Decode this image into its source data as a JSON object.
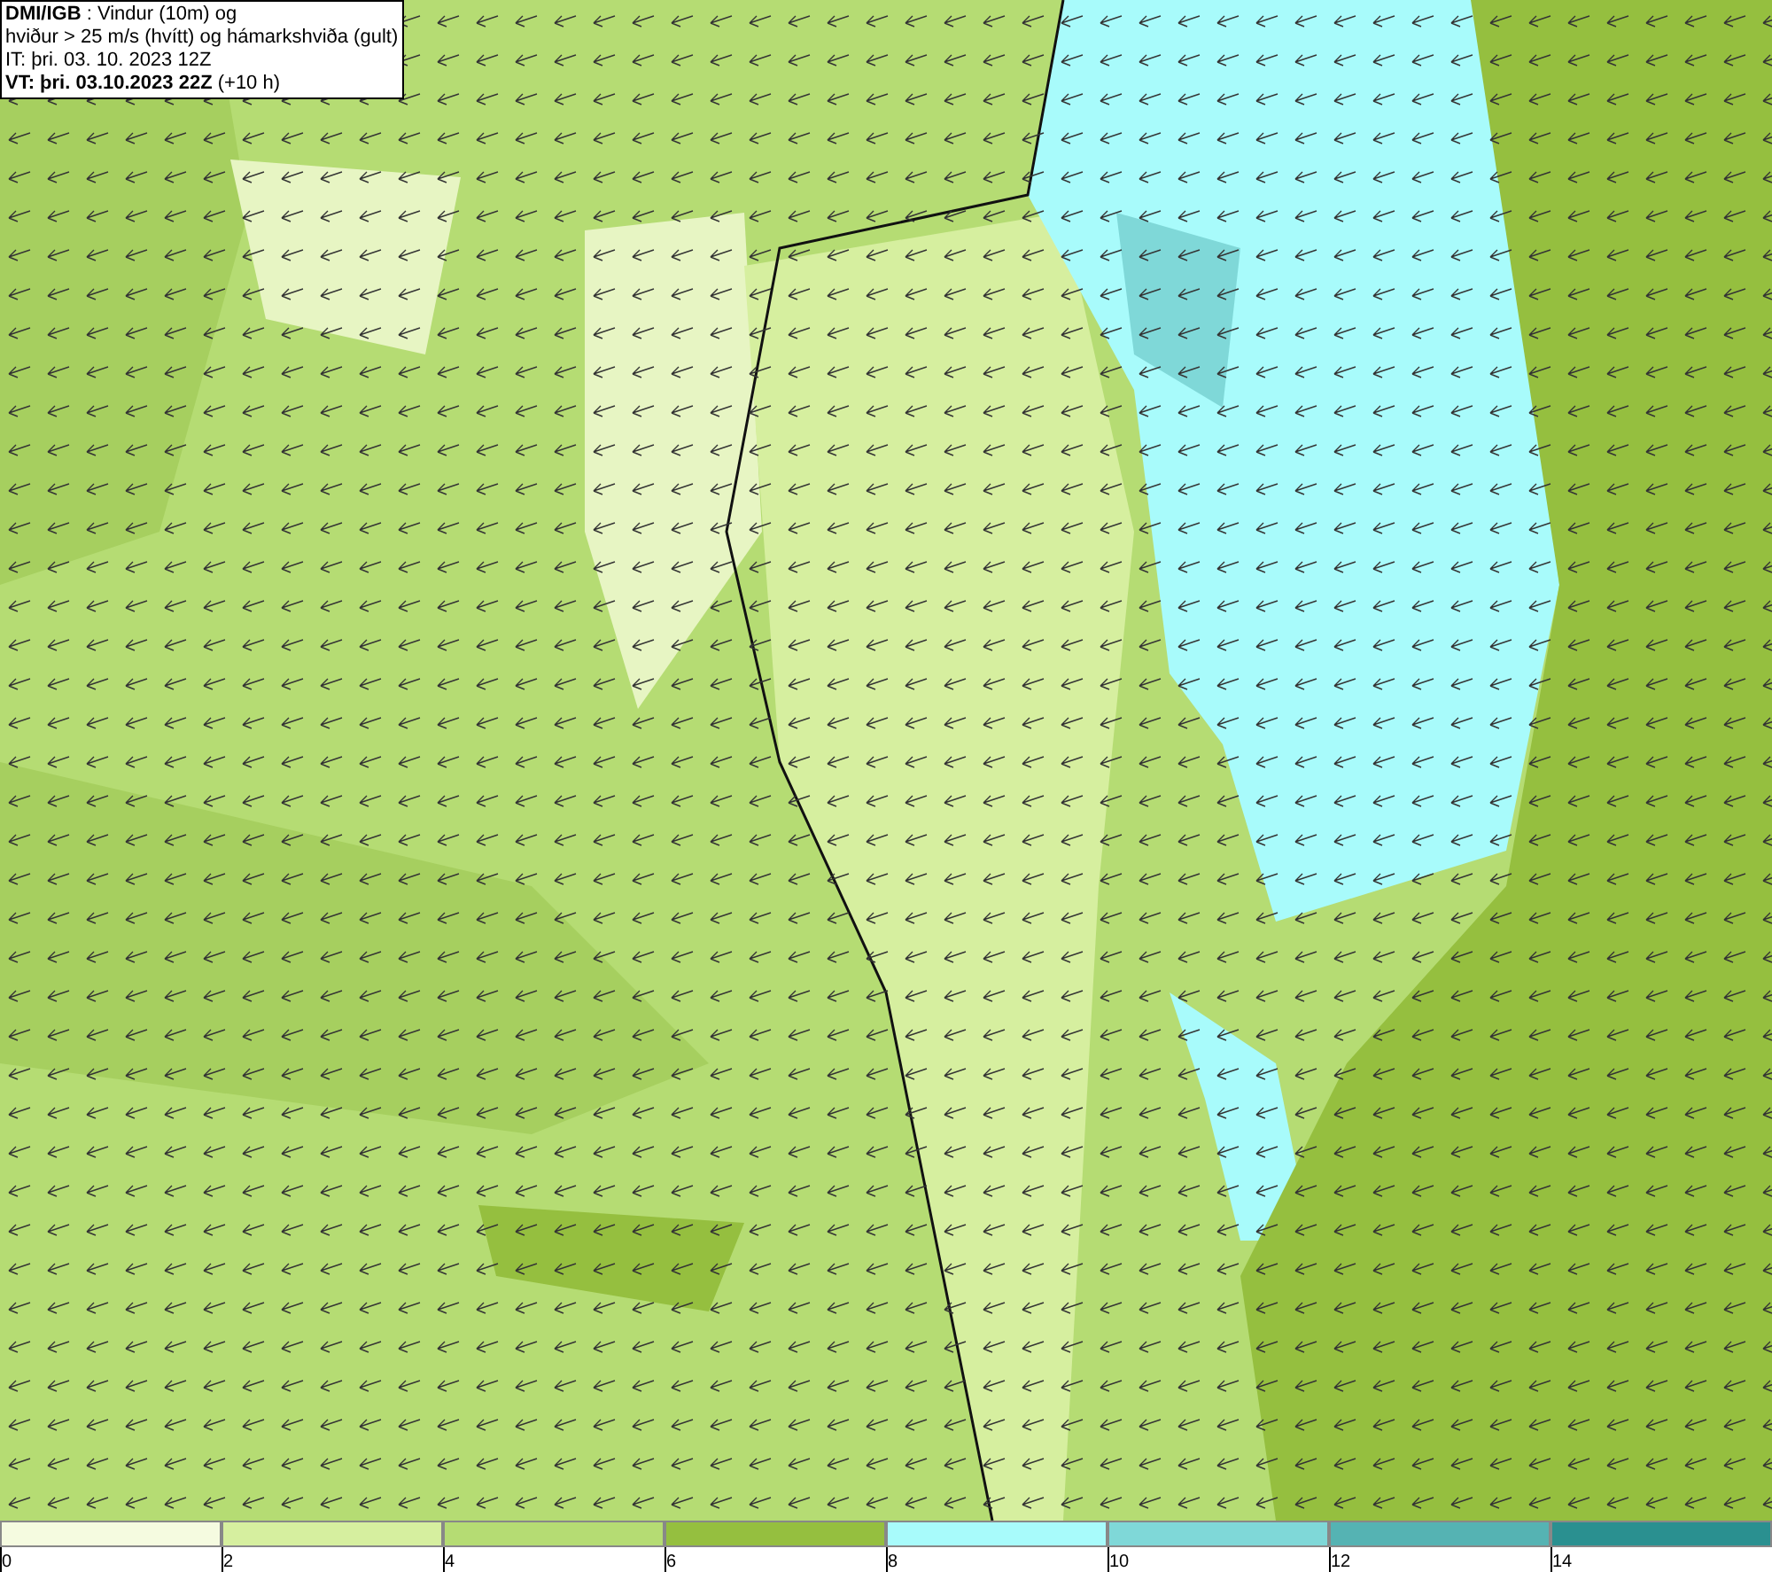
{
  "info_box": {
    "lines": [
      "**DMI/IGB** : Vindur (10m) og",
      "hviður > 25 m/s (hvítt) og hámarkshviða (gult)",
      "IT: þri. 03. 10. 2023 12Z",
      "**VT: þri. 03.10.2023 22Z** (+10 h)"
    ]
  },
  "legend": {
    "bins": [
      {
        "color": "#f5fbe0",
        "label": "0"
      },
      {
        "color": "#d6ef9f",
        "label": "2"
      },
      {
        "color": "#b5dc73",
        "label": "4"
      },
      {
        "color": "#95bf3f",
        "label": "6"
      },
      {
        "color": "#a8fbfb",
        "label": "8"
      },
      {
        "color": "#7fd8d8",
        "label": "10"
      },
      {
        "color": "#55b3b3",
        "label": "12"
      },
      {
        "color": "#2a9090",
        "label": "14"
      }
    ]
  }
}
